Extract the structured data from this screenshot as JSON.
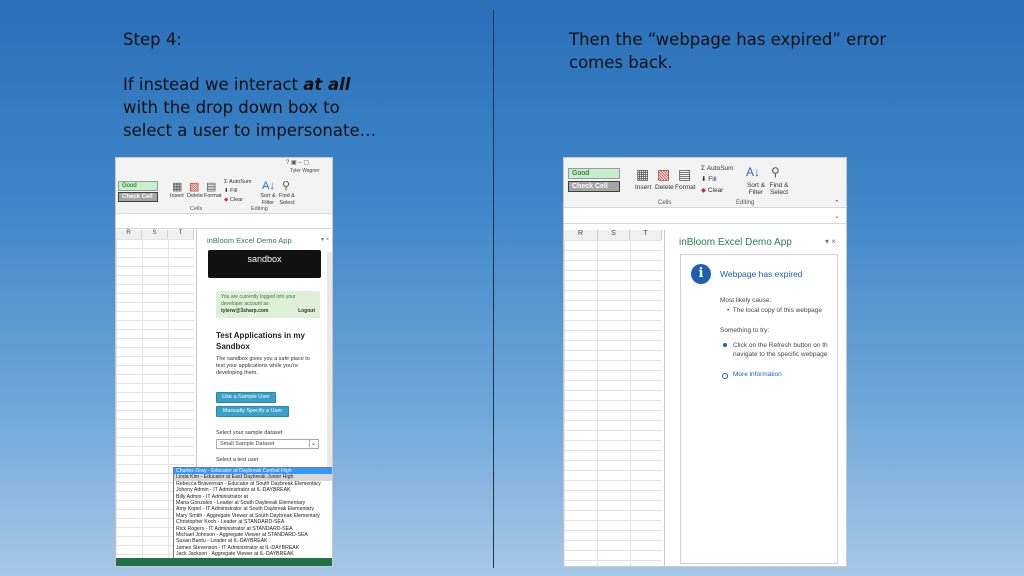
{
  "slide": {
    "step_title": "Step 4:",
    "step_body_pre": "If instead we interact ",
    "step_body_em": "at all",
    "step_body_post": " with the drop down box to select a user to impersonate…",
    "right_text": "Then the “webpage has expired” error comes back."
  },
  "left_screenshot": {
    "user_name": "Tyler Wagner",
    "styles": {
      "good": "Good",
      "check_cell": "Check Cell"
    },
    "ribbon": {
      "insert": "Insert",
      "delete": "Delete",
      "format": "Format",
      "autosum": "AutoSum",
      "fill": "Fill",
      "clear": "Clear",
      "sort_filter": "Sort & Filter",
      "find_select": "Find & Select",
      "group_cells": "Cells",
      "group_editing": "Editing"
    },
    "columns": [
      "R",
      "S",
      "T"
    ],
    "pane_title": "inBloom Excel Demo App",
    "sandbox_label": "sandbox",
    "notice": {
      "line1": "You are currently logged into your",
      "line2": "developer account as:",
      "email": "tylerw@3sharp.com",
      "logout": "Logout"
    },
    "heading": "Test Applications in my Sandbox",
    "description": "The sandbox gives you a safe place to test your applications while you're developing them.",
    "btn_sample": "Use a Sample User",
    "btn_manual": "Manually Specify a User",
    "dataset_label": "Select your sample dataset",
    "dataset_value": "Small Sample Dataset",
    "test_user_label": "Select a test user",
    "users": [
      "Charles Gray - Educator at Daybreak Central High",
      "Linda Kim - Educator at East Daybreak Junior High",
      "Rebecca Braverman - Educator at South Daybreak Elementary",
      "Johnny Admin - IT Administrator at IL-DAYBREAK",
      "Billy Admin - IT Administrator at",
      "Maria Gonzales - Leader at South Daybreak Elementary",
      "Amy Kopel - IT Administrator at South Daybreak Elementary",
      "Mary Smith - Aggregate Viewer at South Daybreak Elementary",
      "Christopher Koch - Leader at STANDARD-SEA",
      "Rick Rogers - IT Administrator at STANDARD-SEA",
      "Michael Johnson - Aggregate Viewer at STANDARD-SEA",
      "Susan Bantu - Leader at IL-DAYBREAK",
      "James Stevenson - IT Administrator at IL-DAYBREAK",
      "Jack Jackson - Aggregate Viewer at IL-DAYBREAK"
    ]
  },
  "right_screenshot": {
    "styles": {
      "good": "Good",
      "check_cell": "Check Cell"
    },
    "ribbon": {
      "insert": "Insert",
      "delete": "Delete",
      "format": "Format",
      "autosum": "AutoSum",
      "fill": "Fill",
      "clear": "Clear",
      "sort_filter": "Sort & Filter",
      "find_select": "Find & Select",
      "group_cells": "Cells",
      "group_editing": "Editing"
    },
    "columns": [
      "R",
      "S",
      "T"
    ],
    "pane_title": "inBloom Excel Demo App",
    "error_title": "Webpage has expired",
    "cause_label": "Most likely cause:",
    "cause_item": "The local copy of this webpage",
    "try_label": "Something to try:",
    "try_item_line1": "Click on the Refresh button on th",
    "try_item_line2": "navigate to the specific webpage",
    "more_info": "More information"
  },
  "colors": {
    "excel_green": "#217346",
    "link_blue": "#1e5fb4",
    "pane_title_green": "#2e7d4f"
  }
}
